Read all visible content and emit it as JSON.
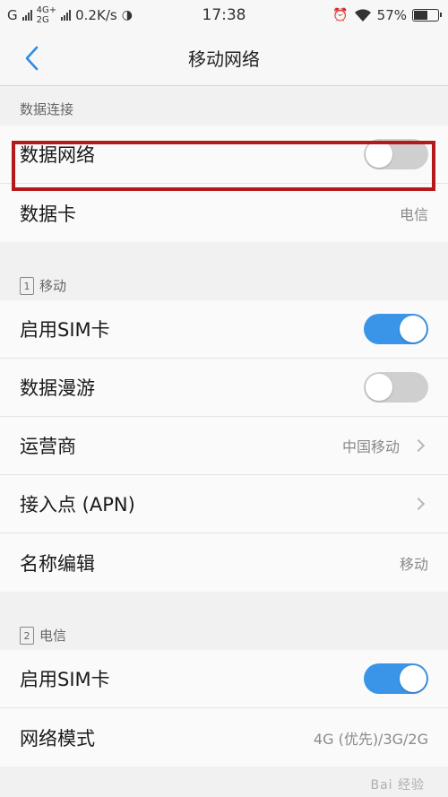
{
  "status_bar": {
    "sim1_label": "G",
    "net_top": "4G+",
    "net_bottom": "2G",
    "speed": "0.2K/s",
    "time": "17:38",
    "battery": "57%"
  },
  "nav": {
    "back_icon": "chevron-left-icon",
    "title": "移动网络"
  },
  "sections": {
    "data": {
      "header": "数据连接",
      "data_network_label": "数据网络",
      "data_network_on": false,
      "data_card_label": "数据卡",
      "data_card_value": "电信"
    },
    "sim1": {
      "icon_number": "1",
      "header": "移动",
      "enable_label": "启用SIM卡",
      "enable_on": true,
      "roaming_label": "数据漫游",
      "roaming_on": false,
      "carrier_label": "运营商",
      "carrier_value": "中国移动",
      "apn_label": "接入点 (APN)",
      "name_label": "名称编辑",
      "name_value": "移动"
    },
    "sim2": {
      "icon_number": "2",
      "header": "电信",
      "enable_label": "启用SIM卡",
      "enable_on": true,
      "mode_label": "网络模式",
      "mode_value": "4G (优先)/3G/2G"
    }
  },
  "watermark": "Bai 经验",
  "colors": {
    "accent": "#3a94e8",
    "toggle_off": "#cfcfcf",
    "highlight": "#b31b1b"
  }
}
